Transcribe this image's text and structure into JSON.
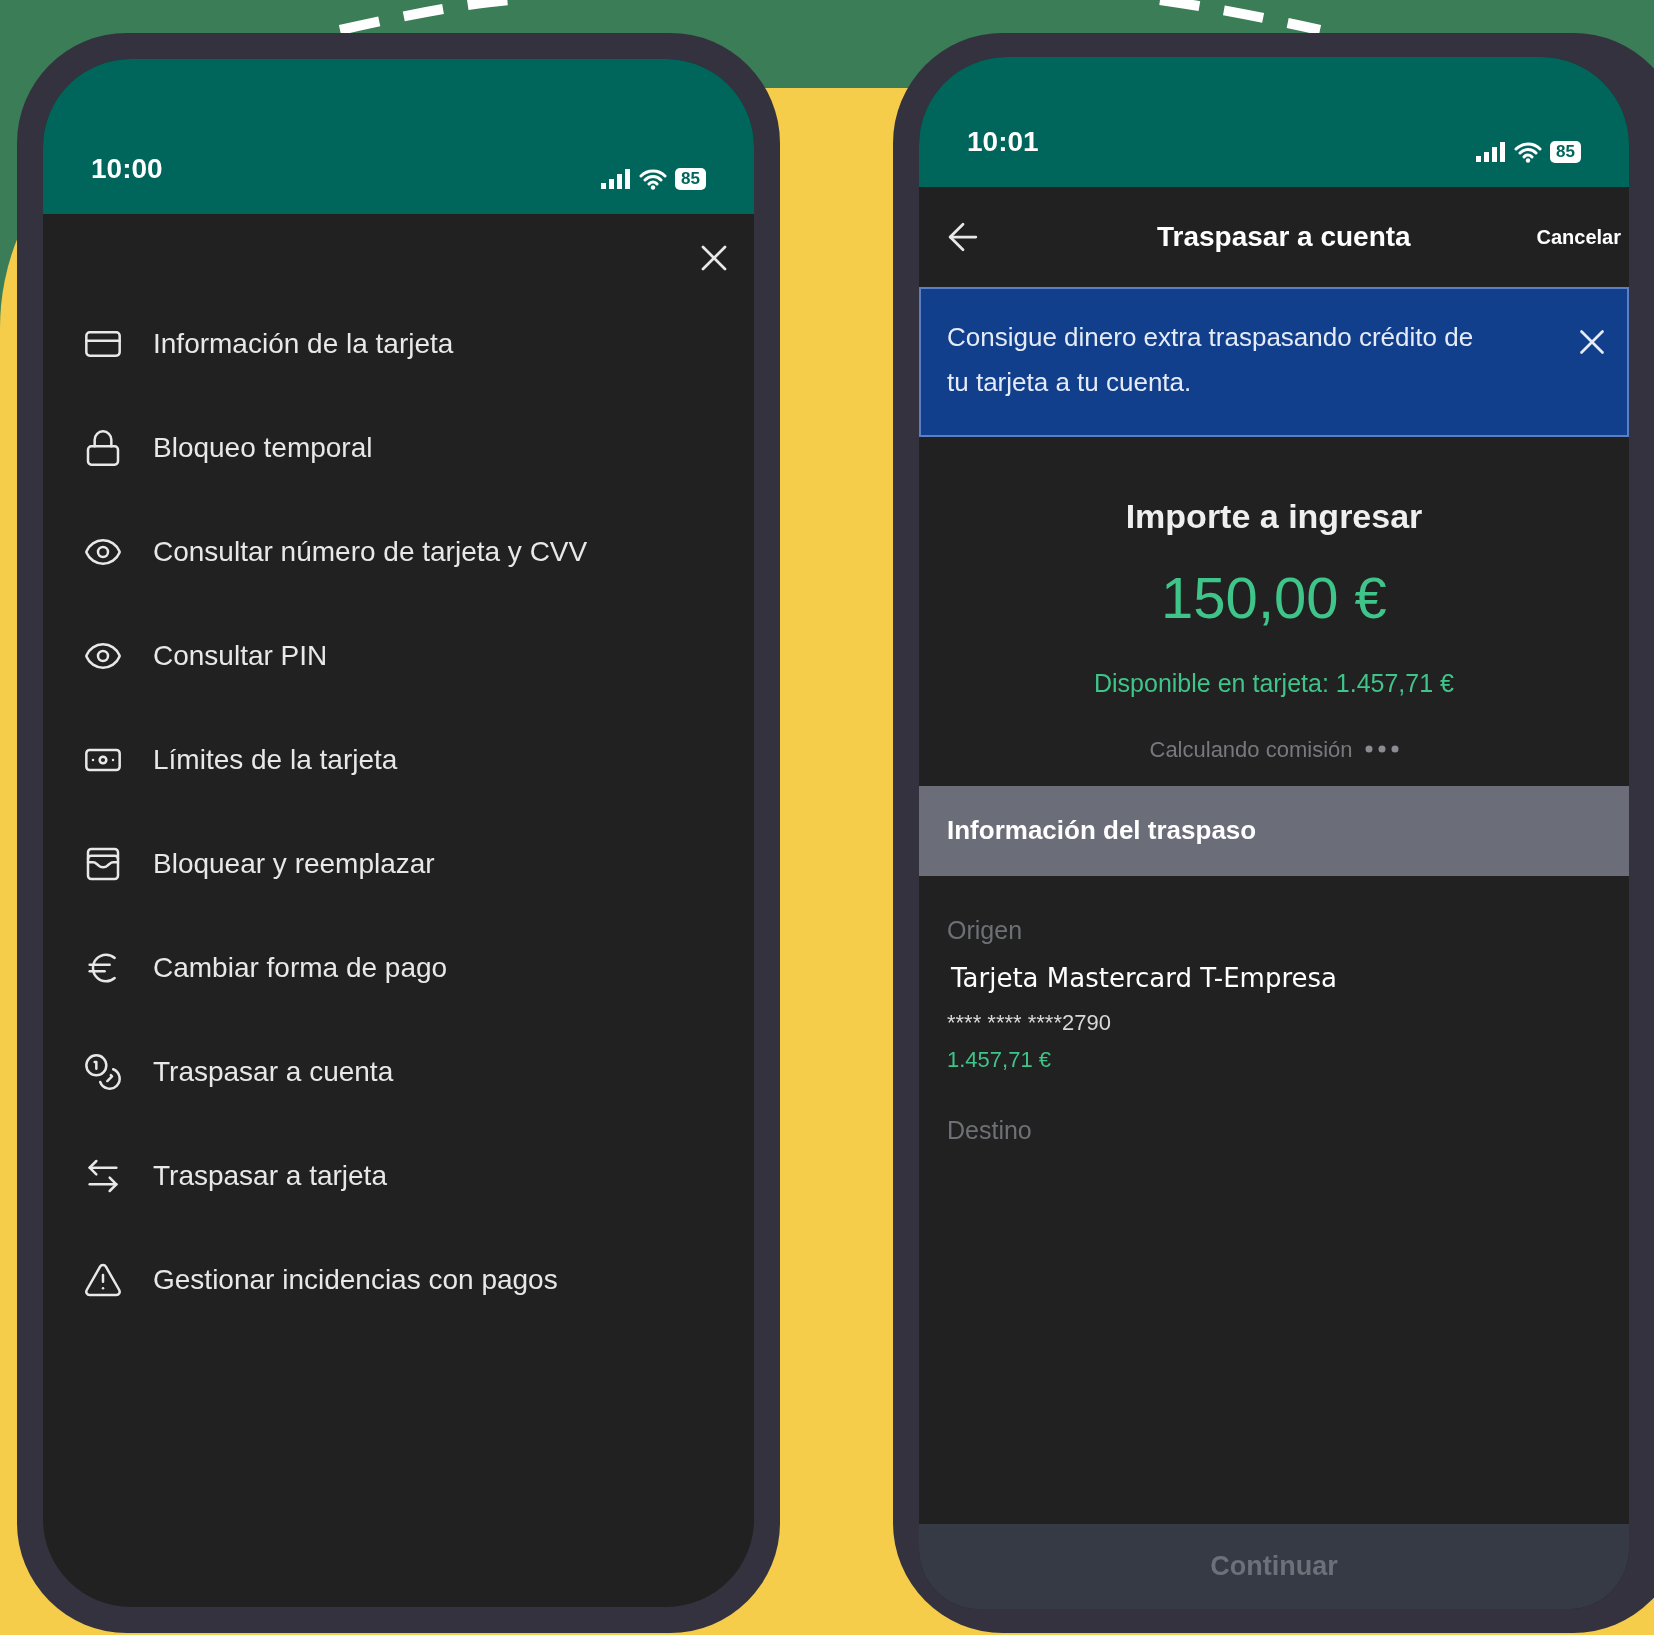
{
  "menu_phone": {
    "status_bar": {
      "time": "10:00",
      "battery": "85"
    },
    "items": [
      {
        "label": "Información de la tarjeta"
      },
      {
        "label": "Bloqueo temporal"
      },
      {
        "label": "Consultar número de tarjeta y CVV"
      },
      {
        "label": "Consultar PIN"
      },
      {
        "label": "Límites de la tarjeta"
      },
      {
        "label": "Bloquear y reemplazar"
      },
      {
        "label": "Cambiar forma de pago"
      },
      {
        "label": "Traspasar a cuenta"
      },
      {
        "label": "Traspasar a tarjeta"
      },
      {
        "label": "Gestionar incidencias con pagos"
      }
    ]
  },
  "transfer_phone": {
    "status_bar": {
      "time": "10:01",
      "battery": "85"
    },
    "header": {
      "title": "Traspasar a cuenta",
      "cancel": "Cancelar"
    },
    "banner": {
      "text": "Consigue dinero extra traspasando crédito de tu tarjeta a tu cuenta."
    },
    "amount_label": "Importe a ingresar",
    "amount": "150,00 €",
    "available": "Disponible en tarjeta: 1.457,71 €",
    "fee_status": "Calculando comisión",
    "section_title": "Información del traspaso",
    "origin": {
      "label": "Origen",
      "name": "Tarjeta Mastercard T-Empresa",
      "number": "**** **** ****2790",
      "balance": "1.457,71 €"
    },
    "destination": {
      "label": "Destino"
    },
    "continue_button": {
      "label": "Continuar",
      "disabled": true
    }
  }
}
